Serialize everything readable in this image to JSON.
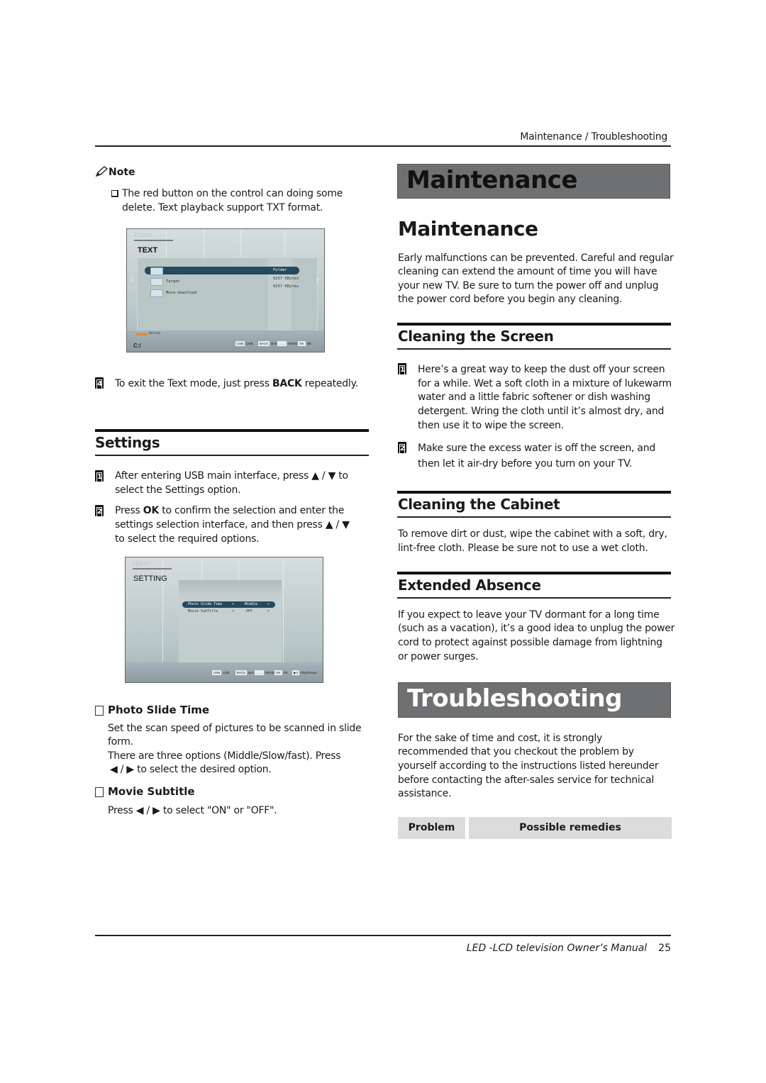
{
  "header": {
    "section_title": "Maintenance / Troubleshooting"
  },
  "left": {
    "note": {
      "icon": "pencil-icon",
      "label": "Note",
      "bullet_icon": "checkbox-icon",
      "text_line1": "The red button on the control can doing some",
      "text_line2": "delete. Text playback support TXT format."
    },
    "text_screen": {
      "brand": "Haier",
      "mode": "TEXT",
      "rows": [
        {
          "name": "",
          "info": "Folder",
          "selected": true
        },
        {
          "name": "Target",
          "info": "6257 KBytes",
          "selected": false
        },
        {
          "name": "Moca-download",
          "info": "6257 KBytes",
          "selected": false
        }
      ],
      "red_key_label": "Delete",
      "path": "C:/",
      "keys": [
        {
          "key": "USB",
          "label": "USB"
        },
        {
          "key": "BACK",
          "label": "BACK"
        },
        {
          "key": "←→",
          "label": "MOVE"
        },
        {
          "key": "OK",
          "label": "OK"
        }
      ]
    },
    "step4": {
      "number": "4",
      "text_before": "To exit the Text mode, just press ",
      "bold": "BACK",
      "text_after": " repeatedly."
    },
    "settings": {
      "title": "Settings",
      "steps": [
        {
          "number": "1",
          "line1": "After entering USB main interface, press ▲ / ▼ to",
          "line2": "select the Settings option."
        },
        {
          "number": "2",
          "line1_before": "Press ",
          "line1_bold": "OK",
          "line1_after": " to confirm the selection and enter the",
          "line2": "settings selection interface, and then press ▲ / ▼",
          "line3": "to select the required options."
        }
      ]
    },
    "setting_screen": {
      "brand": "Haier",
      "mode": "SETTING",
      "options": [
        {
          "name": "Photo Slide Time",
          "left": "<",
          "value": "Middle",
          "right": ">",
          "selected": true
        },
        {
          "name": "Movie SubTitle",
          "left": "<",
          "value": "OFF",
          "right": ">",
          "selected": false
        }
      ],
      "keys": [
        {
          "key": "USB",
          "label": "USB"
        },
        {
          "key": "BACK",
          "label": "BACK"
        },
        {
          "key": "←→",
          "label": "MOVE"
        },
        {
          "key": "OK",
          "label": "OK"
        },
        {
          "key": "▶II",
          "label": "Play/Pause"
        }
      ]
    },
    "photo_slide": {
      "title": "Photo Slide Time",
      "line1": "Set the scan speed of pictures to be scanned in slide",
      "line2": "form.",
      "line3": "There are three options (Middle/Slow/fast). Press",
      "line4": "◀ / ▶  to select the desired option."
    },
    "movie_subtitle": {
      "title": "Movie Subtitle",
      "line1": "Press  ◀ / ▶  to select \"ON\" or \"OFF\"."
    }
  },
  "right": {
    "banner_maintenance": "Maintenance",
    "maintenance": {
      "title": "Maintenance",
      "lines": [
        "Early malfunctions can be prevented. Careful and regular",
        "cleaning can extend the amount of time you will have",
        "your new TV. Be sure to turn the power off and unplug",
        "the power cord before you begin any cleaning."
      ]
    },
    "cleaning_screen": {
      "title": "Cleaning the Screen",
      "step1_number": "1",
      "step1_lines": [
        "Here’s a great way to keep the dust off your screen",
        "for a while. Wet a soft cloth in a mixture of lukewarm",
        "water and a little fabric softener or dish washing",
        "detergent. Wring the cloth until it’s almost dry, and",
        "then use it to wipe the screen."
      ],
      "step2_number": "2",
      "step2_lines": [
        "Make sure the excess water is off the screen, and",
        "then let it air-dry before you turn on your TV."
      ]
    },
    "cleaning_cabinet": {
      "title": "Cleaning the Cabinet",
      "lines": [
        "To remove dirt or dust, wipe the cabinet with a soft, dry,",
        "lint-free cloth. Please be sure not to use a wet cloth."
      ]
    },
    "extended_absence": {
      "title": "Extended Absence",
      "lines": [
        "If you expect to leave your TV dormant for a long time",
        "(such as a vacation), it’s a good idea to unplug the power",
        "cord to protect against possible damage from lightning",
        "or power surges."
      ]
    },
    "banner_troubleshooting": "Troubleshooting",
    "troubleshooting": {
      "lines": [
        "For the sake of time and cost, it is strongly",
        "recommended that you checkout the problem by",
        "yourself according to the instructions listed hereunder",
        "before contacting the after-sales service for technical",
        "assistance."
      ],
      "table_headers": [
        "Problem",
        "Possible remedies"
      ]
    }
  },
  "footer": {
    "manual_title": "LED -LCD television Owner’s Manual",
    "page_number": "25"
  },
  "colors": {
    "banner_bg": "#6f7072",
    "banner_maintenance_text": "#111111",
    "banner_troubleshooting_text": "#ffffff",
    "table_header_bg": "#dcdcdd",
    "tv_highlight": "#26495f"
  }
}
